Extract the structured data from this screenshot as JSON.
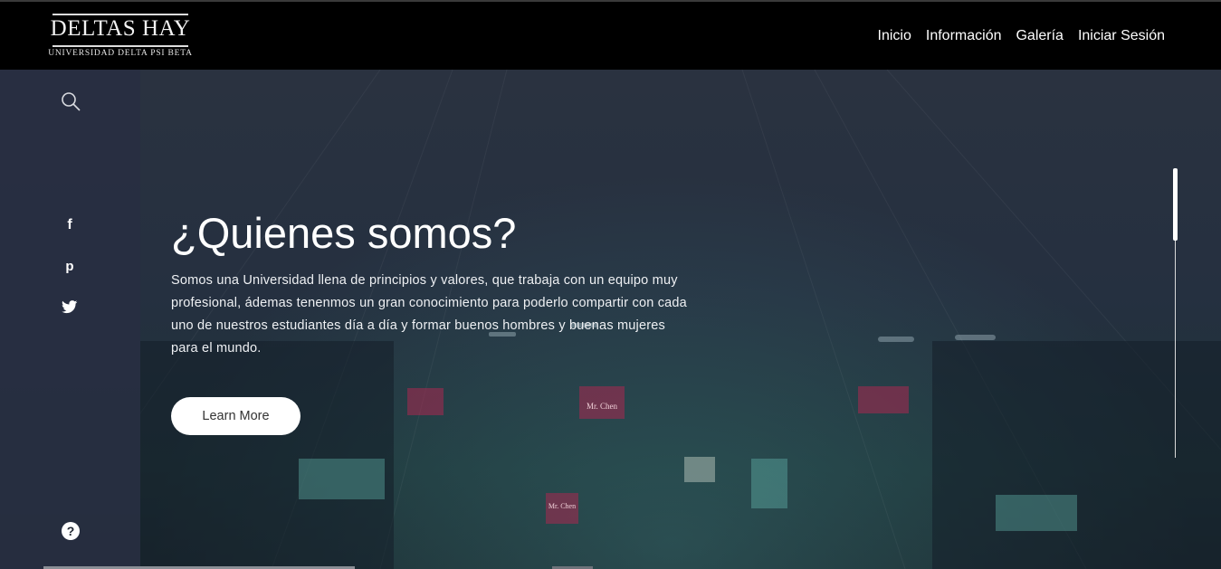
{
  "brand": {
    "name": "DELTAS HAY",
    "subtitle": "UNIVERSIDAD DELTA PSI BETA"
  },
  "nav": {
    "items": [
      {
        "label": "Inicio"
      },
      {
        "label": "Información"
      },
      {
        "label": "Galería"
      },
      {
        "label": "Iniciar Sesión"
      }
    ]
  },
  "sidebar": {
    "icons": [
      "search-icon",
      "facebook-icon",
      "pinterest-icon",
      "twitter-icon",
      "help-icon"
    ],
    "facebook_glyph": "f",
    "pinterest_glyph": "p",
    "help_glyph": "?"
  },
  "hero": {
    "title": "¿Quienes somos?",
    "description": "Somos una Universidad llena de principios y valores, que trabaja con un equipo muy profesional, ádemas tenenmos un gran conocimiento para poderlo compartir con cada uno de nuestros estudiantes día a día y formar buenos hombres y buenas mujeres para el mundo.",
    "button_label": "Learn More",
    "scroll_position": 0.0
  },
  "background_signs": [
    "Mr. Chen",
    "Mr. Chen"
  ],
  "colors": {
    "header_bg": "#000000",
    "hero_bg": "#253040",
    "button_bg": "#ffffff",
    "text": "#ffffff"
  }
}
